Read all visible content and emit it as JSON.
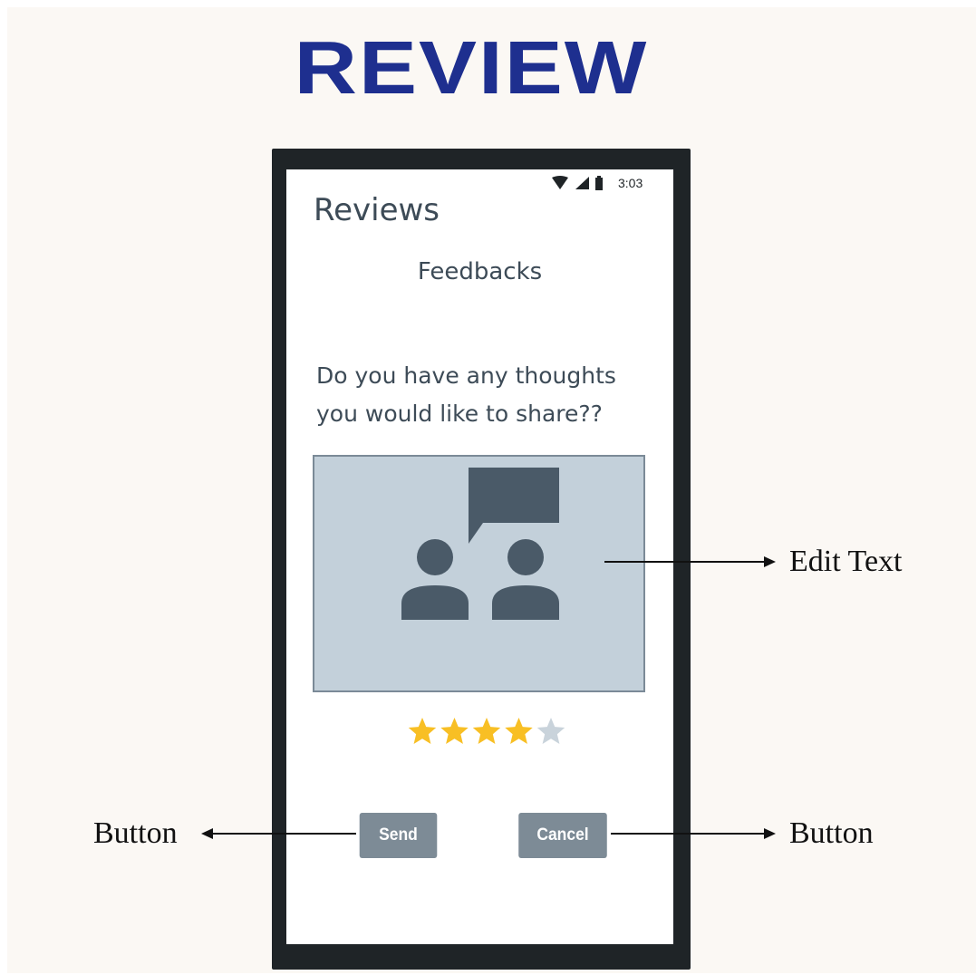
{
  "header": {
    "title": "REVIEW"
  },
  "status_bar": {
    "time": "3:03",
    "icons": [
      "wifi-icon",
      "signal-icon",
      "battery-icon"
    ]
  },
  "app": {
    "title": "Reviews",
    "subtitle": "Feedbacks",
    "question_line1": "Do you have any thoughts",
    "question_line2": "you would like to share??",
    "edit_text_icon": "people-chat-icon",
    "rating": {
      "value": 4,
      "max": 5,
      "filled_color": "#f8bf24",
      "empty_color": "#c9d3db"
    },
    "buttons": {
      "send": "Send",
      "cancel": "Cancel"
    }
  },
  "annotations": {
    "edit_text_label": "Edit Text",
    "button_left_label": "Button",
    "button_right_label": "Button"
  },
  "colors": {
    "title": "#1e2f8f",
    "phone_frame": "#1f2427",
    "button": "#7d8b96",
    "edit_box": "#c3d0da",
    "icon": "#4a5a68",
    "background": "#fbf8f4"
  }
}
